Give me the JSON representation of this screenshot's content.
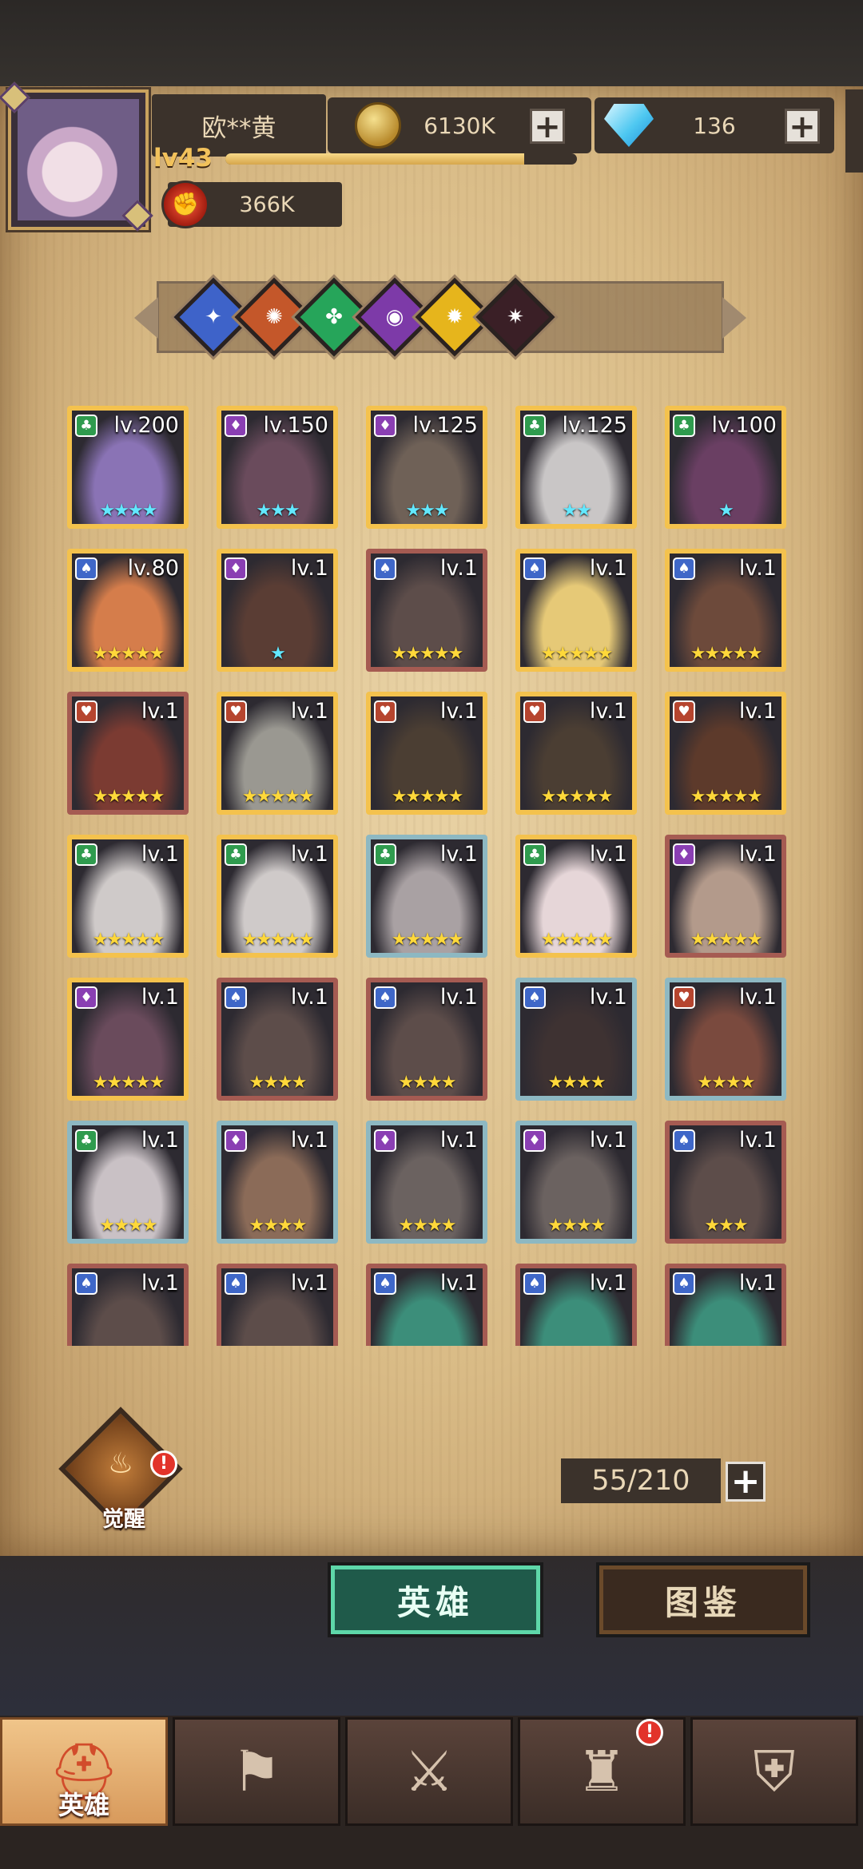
{
  "player": {
    "name": "欧**黄",
    "level": "lv43",
    "xp_progress": 0.85,
    "power": "366K"
  },
  "resources": {
    "gold": "6130K",
    "diamonds": "136"
  },
  "factions": [
    {
      "name": "faction-light",
      "color": "#3e63c9"
    },
    {
      "name": "faction-fire",
      "color": "#c4572a"
    },
    {
      "name": "faction-nature",
      "color": "#26a55a"
    },
    {
      "name": "faction-shadow",
      "color": "#7d3aa8"
    },
    {
      "name": "faction-radiant",
      "color": "#e6b51c"
    },
    {
      "name": "faction-dark",
      "color": "#3a1f26"
    }
  ],
  "heroes": [
    {
      "level": "lv.200",
      "stars": "★★★★",
      "star_color": "blue",
      "rarity": "legendary",
      "cls": "green",
      "tone": "#8a73b5"
    },
    {
      "level": "lv.150",
      "stars": "★★★",
      "star_color": "blue",
      "rarity": "legendary",
      "cls": "purple",
      "tone": "#6a4b5c"
    },
    {
      "level": "lv.125",
      "stars": "★★★",
      "star_color": "blue",
      "rarity": "legendary",
      "cls": "purple",
      "tone": "#6f6157"
    },
    {
      "level": "lv.125",
      "stars": "★★",
      "star_color": "blue",
      "rarity": "legendary",
      "cls": "green",
      "tone": "#c9c6c6"
    },
    {
      "level": "lv.100",
      "stars": "★",
      "star_color": "blue",
      "rarity": "legendary",
      "cls": "green",
      "tone": "#6a3f63"
    },
    {
      "level": "lv.80",
      "stars": "★★★★★",
      "star_color": "gold",
      "rarity": "legendary",
      "cls": "blue",
      "tone": "#d57d4b"
    },
    {
      "level": "lv.1",
      "stars": "★",
      "star_color": "blue",
      "rarity": "legendary",
      "cls": "purple",
      "tone": "#5a3d34"
    },
    {
      "level": "lv.1",
      "stars": "★★★★★",
      "star_color": "gold",
      "rarity": "rare",
      "cls": "blue",
      "tone": "#5d4d4a"
    },
    {
      "level": "lv.1",
      "stars": "★★★★★",
      "star_color": "gold",
      "rarity": "legendary",
      "cls": "blue",
      "tone": "#e6c977"
    },
    {
      "level": "lv.1",
      "stars": "★★★★★",
      "star_color": "gold",
      "rarity": "legendary",
      "cls": "blue",
      "tone": "#6d4a3b"
    },
    {
      "level": "lv.1",
      "stars": "★★★★★",
      "star_color": "gold",
      "rarity": "rare",
      "cls": "red",
      "tone": "#7b3b32"
    },
    {
      "level": "lv.1",
      "stars": "★★★★★",
      "star_color": "gold",
      "rarity": "legendary",
      "cls": "red",
      "tone": "#9a9891"
    },
    {
      "level": "lv.1",
      "stars": "★★★★★",
      "star_color": "gold",
      "rarity": "legendary",
      "cls": "red",
      "tone": "#4b3e33"
    },
    {
      "level": "lv.1",
      "stars": "★★★★★",
      "star_color": "gold",
      "rarity": "legendary",
      "cls": "red",
      "tone": "#4b3e33"
    },
    {
      "level": "lv.1",
      "stars": "★★★★★",
      "star_color": "gold",
      "rarity": "legendary",
      "cls": "red",
      "tone": "#5d3a2b"
    },
    {
      "level": "lv.1",
      "stars": "★★★★★",
      "star_color": "gold",
      "rarity": "legendary",
      "cls": "green",
      "tone": "#cfcac9"
    },
    {
      "level": "lv.1",
      "stars": "★★★★★",
      "star_color": "gold",
      "rarity": "legendary",
      "cls": "green",
      "tone": "#cfcac9"
    },
    {
      "level": "lv.1",
      "stars": "★★★★★",
      "star_color": "gold",
      "rarity": "common",
      "cls": "green",
      "tone": "#a9a1a3"
    },
    {
      "level": "lv.1",
      "stars": "★★★★★",
      "star_color": "gold",
      "rarity": "legendary",
      "cls": "green",
      "tone": "#e6d6d8"
    },
    {
      "level": "lv.1",
      "stars": "★★★★★",
      "star_color": "gold",
      "rarity": "rare",
      "cls": "purple",
      "tone": "#b39a8b"
    },
    {
      "level": "lv.1",
      "stars": "★★★★★",
      "star_color": "gold",
      "rarity": "legendary",
      "cls": "purple",
      "tone": "#6a4b5c"
    },
    {
      "level": "lv.1",
      "stars": "★★★★",
      "star_color": "gold",
      "rarity": "rare",
      "cls": "blue",
      "tone": "#5d4d4a"
    },
    {
      "level": "lv.1",
      "stars": "★★★★",
      "star_color": "gold",
      "rarity": "rare",
      "cls": "blue",
      "tone": "#5d4d4a"
    },
    {
      "level": "lv.1",
      "stars": "★★★★",
      "star_color": "gold",
      "rarity": "common",
      "cls": "blue",
      "tone": "#3e3232"
    },
    {
      "level": "lv.1",
      "stars": "★★★★",
      "star_color": "gold",
      "rarity": "common",
      "cls": "red",
      "tone": "#7a4a3e"
    },
    {
      "level": "lv.1",
      "stars": "★★★★",
      "star_color": "gold",
      "rarity": "common",
      "cls": "green",
      "tone": "#c9c1c5"
    },
    {
      "level": "lv.1",
      "stars": "★★★★",
      "star_color": "gold",
      "rarity": "common",
      "cls": "purple",
      "tone": "#8b6b58"
    },
    {
      "level": "lv.1",
      "stars": "★★★★",
      "star_color": "gold",
      "rarity": "common",
      "cls": "purple",
      "tone": "#6b6260"
    },
    {
      "level": "lv.1",
      "stars": "★★★★",
      "star_color": "gold",
      "rarity": "common",
      "cls": "purple",
      "tone": "#6b6260"
    },
    {
      "level": "lv.1",
      "stars": "★★★",
      "star_color": "gold",
      "rarity": "rare",
      "cls": "blue",
      "tone": "#5d4d4a"
    },
    {
      "level": "lv.1",
      "stars": "",
      "star_color": "gold",
      "rarity": "rare",
      "cls": "blue",
      "tone": "#5d4d4a"
    },
    {
      "level": "lv.1",
      "stars": "",
      "star_color": "gold",
      "rarity": "rare",
      "cls": "blue",
      "tone": "#5d4d4a"
    },
    {
      "level": "lv.1",
      "stars": "",
      "star_color": "gold",
      "rarity": "rare",
      "cls": "blue",
      "tone": "#3c8e7a"
    },
    {
      "level": "lv.1",
      "stars": "",
      "star_color": "gold",
      "rarity": "rare",
      "cls": "blue",
      "tone": "#3c8e7a"
    },
    {
      "level": "lv.1",
      "stars": "",
      "star_color": "gold",
      "rarity": "rare",
      "cls": "blue",
      "tone": "#3c8e7a"
    }
  ],
  "awaken": {
    "label": "觉醒",
    "badge": "!"
  },
  "capacity": "55/210",
  "tabs": {
    "heroes": "英雄",
    "codex": "图鉴"
  },
  "nav": [
    {
      "name": "nav-heroes",
      "label": "英雄",
      "icon": "helmet-icon",
      "glyph": "⛑",
      "active": true
    },
    {
      "name": "nav-expedition",
      "label": "",
      "icon": "flag-icon",
      "glyph": "⚑",
      "active": false
    },
    {
      "name": "nav-battle",
      "label": "",
      "icon": "crossed-swords-icon",
      "glyph": "⚔",
      "active": false
    },
    {
      "name": "nav-castle",
      "label": "",
      "icon": "castle-icon",
      "glyph": "♜",
      "active": false,
      "badge": "!"
    },
    {
      "name": "nav-guild",
      "label": "",
      "icon": "handshake-shield-icon",
      "glyph": "⛨",
      "active": false
    }
  ],
  "colors": {
    "legendary_frame": "#f4c24d",
    "rare_frame": "#a55b52",
    "common_frame": "#8db8c2",
    "class_green": "#2f9b4e",
    "class_purple": "#8a3fb3",
    "class_blue": "#3f67c8",
    "class_red": "#b6452f"
  }
}
